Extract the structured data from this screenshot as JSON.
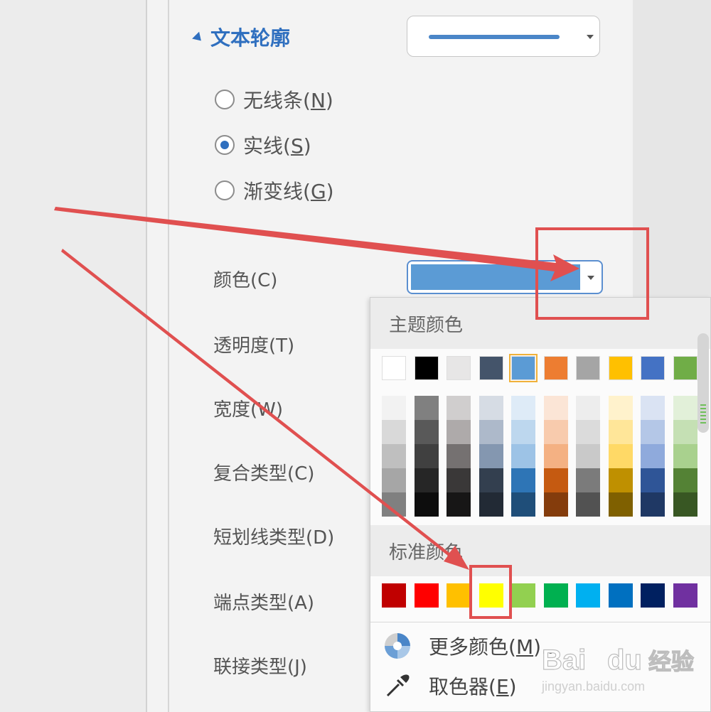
{
  "section": {
    "title": "文本轮廓"
  },
  "line_options": {
    "none": {
      "text": "无线条(",
      "key": "N",
      "end": ")"
    },
    "solid": {
      "text": "实线(",
      "key": "S",
      "end": ")"
    },
    "gradient": {
      "text": "渐变线(",
      "key": "G",
      "end": ")"
    }
  },
  "properties": {
    "color": "颜色(C)",
    "transparency": "透明度(T)",
    "width": "宽度(W)",
    "compound": "复合类型(C)",
    "dash": "短划线类型(D)",
    "cap": "端点类型(A)",
    "join": "联接类型(J)"
  },
  "popup": {
    "theme_title": "主题颜色",
    "standard_title": "标准颜色",
    "more_colors": {
      "text": "更多颜色(",
      "key": "M",
      "end": ")..."
    },
    "eyedropper": {
      "text": "取色器(",
      "key": "E",
      "end": ")"
    }
  },
  "colors": {
    "accent": "#2f6fbf",
    "current_color": "#5b9bd5",
    "highlight": "#e05050",
    "theme": [
      "#ffffff",
      "#000000",
      "#e7e6e6",
      "#44546a",
      "#5b9bd5",
      "#ed7d31",
      "#a5a5a5",
      "#ffc000",
      "#4472c4",
      "#70ad47"
    ],
    "theme_selected_index": 4,
    "theme_shades": [
      [
        "#f2f2f2",
        "#d9d9d9",
        "#bfbfbf",
        "#a6a6a6",
        "#808080"
      ],
      [
        "#808080",
        "#595959",
        "#404040",
        "#262626",
        "#0d0d0d"
      ],
      [
        "#d0cece",
        "#aeaaaa",
        "#757171",
        "#3a3838",
        "#171616"
      ],
      [
        "#d6dce4",
        "#adb9ca",
        "#8497b0",
        "#333f4f",
        "#222a35"
      ],
      [
        "#deebf7",
        "#bdd7ee",
        "#9dc3e6",
        "#2e75b6",
        "#1f4e79"
      ],
      [
        "#fbe5d6",
        "#f8cbad",
        "#f4b183",
        "#c55a11",
        "#843c0c"
      ],
      [
        "#ededed",
        "#dbdbdb",
        "#c9c9c9",
        "#7b7b7b",
        "#525252"
      ],
      [
        "#fff2cc",
        "#ffe699",
        "#ffd966",
        "#bf9000",
        "#7f6000"
      ],
      [
        "#dae3f3",
        "#b4c7e7",
        "#8faadc",
        "#2f5597",
        "#1f3864"
      ],
      [
        "#e2f0d9",
        "#c5e0b4",
        "#a9d18e",
        "#548235",
        "#385723"
      ]
    ],
    "standard": [
      "#c00000",
      "#ff0000",
      "#ffc000",
      "#ffff00",
      "#92d050",
      "#00b050",
      "#00b0f0",
      "#0070c0",
      "#002060",
      "#7030a0"
    ]
  },
  "watermark": {
    "brand": "Bai",
    "brand2": "du",
    "cn": "经验",
    "url": "jingyan.baidu.com"
  }
}
